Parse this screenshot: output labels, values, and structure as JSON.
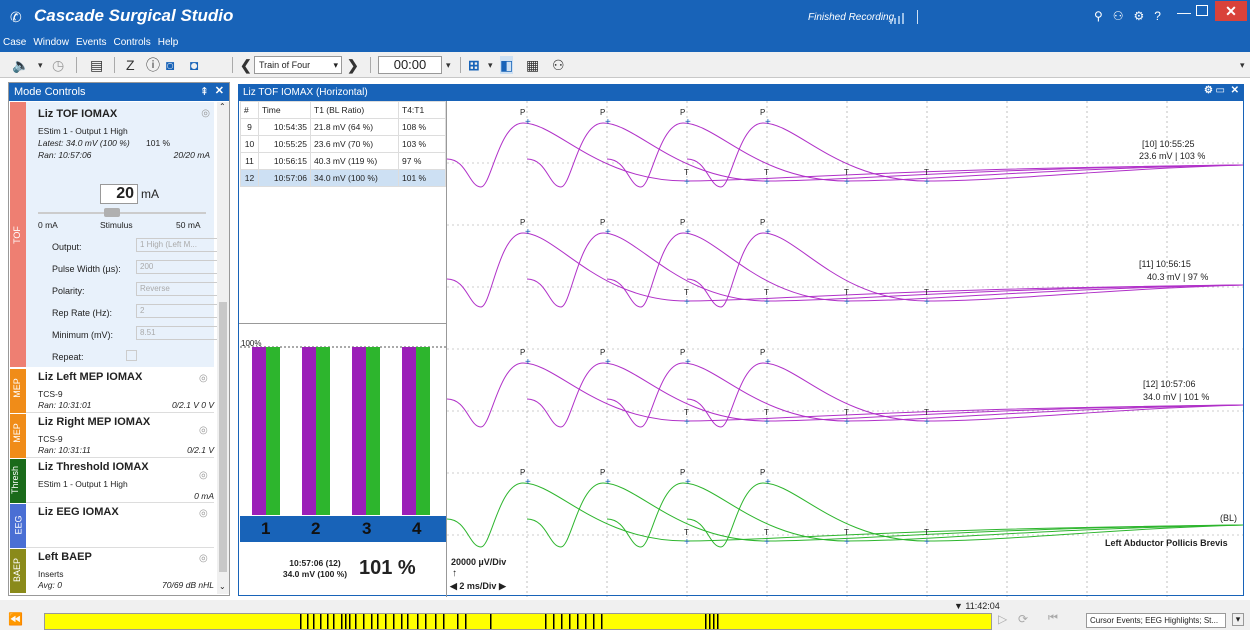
{
  "app": {
    "title": "Cascade Surgical Studio",
    "status": "Finished Recording"
  },
  "menu": [
    "Case",
    "Window",
    "Events",
    "Controls",
    "Help"
  ],
  "toolbar": {
    "protocol": "Train of Four",
    "timer": "00:00"
  },
  "mode_controls": {
    "title": "Mode Controls",
    "tof": {
      "side_label": "TOF",
      "name": "Liz TOF IOMAX",
      "line1": "EStim 1 - Output 1 High",
      "latest": "Latest: 34.0 mV (100 %)",
      "latest_pct": "101 %",
      "ran": "Ran: 10:57:06",
      "ran_value": "20/20 mA",
      "stim_value": "20",
      "stim_unit": "mA",
      "slider_min": "0 mA",
      "slider_label": "Stimulus",
      "slider_max": "50 mA",
      "fields": [
        {
          "label": "Output:",
          "value": "1 High (Left M..."
        },
        {
          "label": "Pulse Width (µs):",
          "value": "200"
        },
        {
          "label": "Polarity:",
          "value": "Reverse"
        },
        {
          "label": "Rep Rate (Hz):",
          "value": "2"
        },
        {
          "label": "Minimum (mV):",
          "value": "8.51"
        },
        {
          "label": "Repeat:",
          "value": ""
        }
      ]
    },
    "cards": [
      {
        "side": "MEP",
        "name": "Liz Left MEP IOMAX",
        "line1": "TCS-9",
        "ran": "Ran: 10:31:01",
        "value": "0/2.1 V 0 V"
      },
      {
        "side": "MEP",
        "name": "Liz Right MEP IOMAX",
        "line1": "TCS-9",
        "ran": "Ran: 10:31:11",
        "value": "0/2.1 V"
      },
      {
        "side": "Thresh",
        "name": "Liz Threshold IOMAX",
        "line1": "EStim 1 - Output 1 High",
        "ran": "",
        "value": "0 mA"
      },
      {
        "side": "EEG",
        "name": "Liz EEG IOMAX",
        "line1": "",
        "ran": "",
        "value": ""
      },
      {
        "side": "BAEP",
        "name": "Left BAEP",
        "line1": "Inserts",
        "ran": "Avg: 0",
        "value": "70/69 dB nHL"
      }
    ]
  },
  "window": {
    "title": "Liz TOF IOMAX (Horizontal)",
    "table": {
      "headers": [
        "#",
        "Time",
        "T1 (BL Ratio)",
        "T4:T1"
      ],
      "rows": [
        [
          "9",
          "10:54:35",
          "21.8 mV (64 %)",
          "108 %"
        ],
        [
          "10",
          "10:55:25",
          "23.6 mV (70 %)",
          "103 %"
        ],
        [
          "11",
          "10:56:15",
          "40.3 mV (119 %)",
          "97 %"
        ],
        [
          "12",
          "10:57:06",
          "34.0 mV (100 %)",
          "101 %"
        ]
      ]
    },
    "bars": {
      "ref_label": "100%",
      "labels": [
        "1",
        "2",
        "3",
        "4"
      ],
      "colors": [
        "#9b1fb8",
        "#2db52d"
      ]
    },
    "summary": {
      "time": "10:57:06 (12)",
      "value": "34.0 mV (100 %)",
      "pct": "101 %"
    },
    "scale": {
      "vdiv": "20000 µV/Div",
      "hdiv": "2 ms/Div"
    },
    "traces": [
      {
        "label1": "[10] 10:55:25",
        "label2": "23.6 mV | 103 %",
        "color": "#b030c8"
      },
      {
        "label1": "[11] 10:56:15",
        "label2": "40.3 mV | 97 %",
        "color": "#b030c8"
      },
      {
        "label1": "[12] 10:57:06",
        "label2": "34.0 mV | 101 %",
        "color": "#b030c8"
      },
      {
        "label1": "",
        "label2": "(BL)",
        "color": "#2db52d"
      }
    ],
    "muscle": "Left Abductor Pollicis Brevis",
    "peak_label": "P",
    "trough_label": "T"
  },
  "timeline": {
    "time": "▼ 11:42:04",
    "filter": "Cursor Events; EEG Highlights; St..."
  }
}
